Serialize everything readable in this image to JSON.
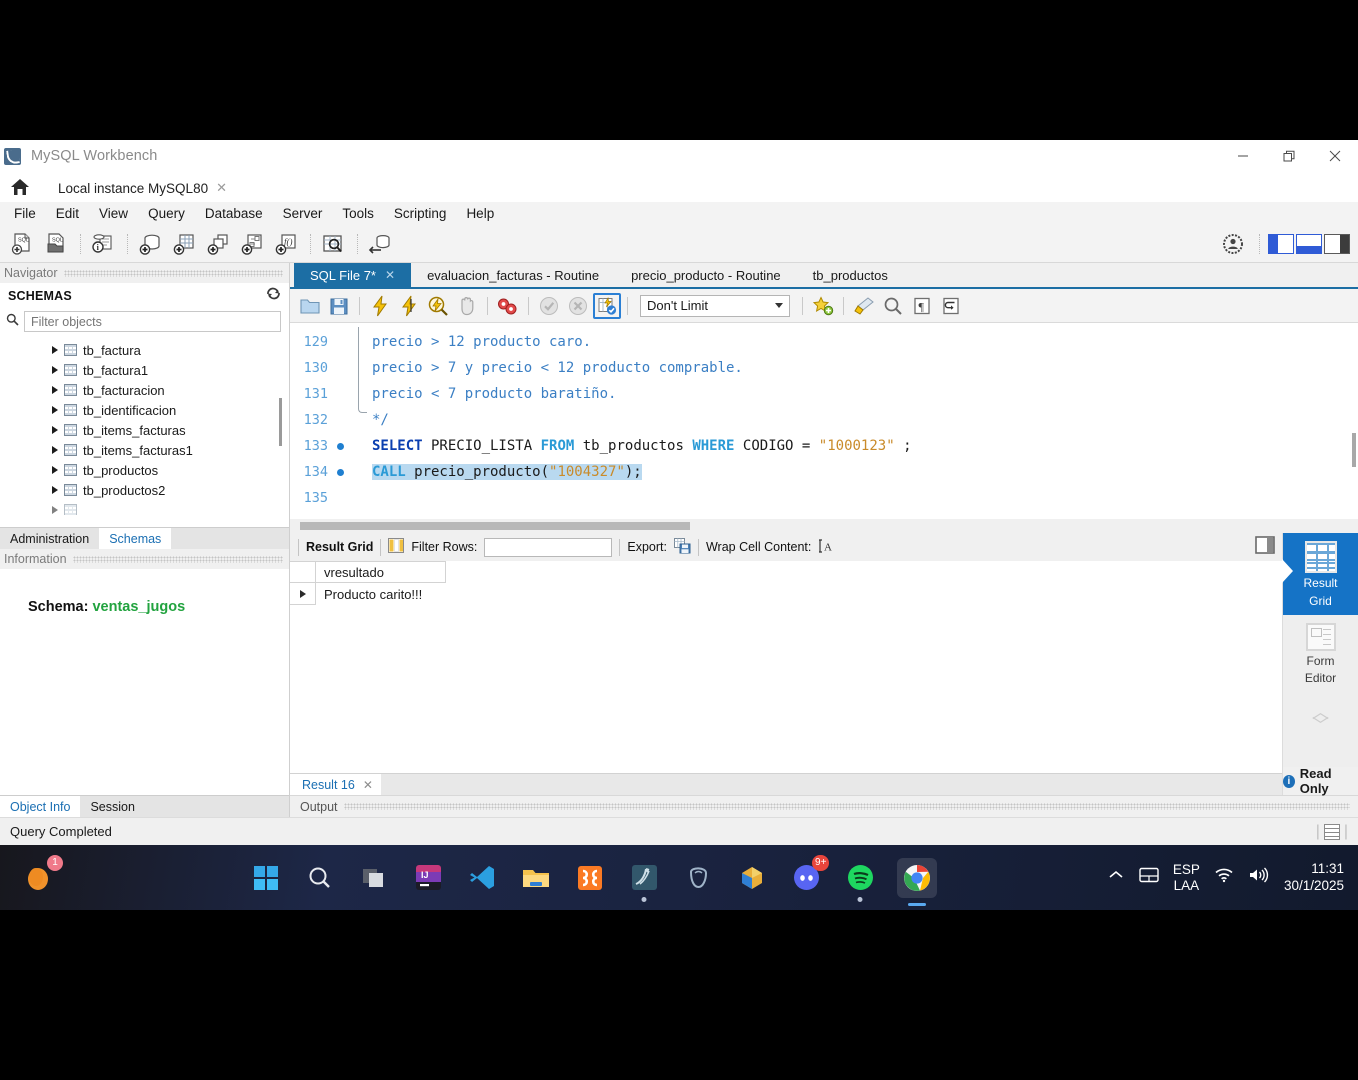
{
  "window": {
    "title": "MySQL Workbench",
    "minimize_label": "—",
    "maximize_label": "❐",
    "close_label": "✕"
  },
  "connection_tab": {
    "label": "Local instance MySQL80",
    "close_label": "✕"
  },
  "menubar": {
    "items": [
      {
        "label": "File"
      },
      {
        "label": "Edit"
      },
      {
        "label": "View"
      },
      {
        "label": "Query"
      },
      {
        "label": "Database"
      },
      {
        "label": "Server"
      },
      {
        "label": "Tools"
      },
      {
        "label": "Scripting"
      },
      {
        "label": "Help"
      }
    ]
  },
  "main_toolbar": {
    "buttons": [
      {
        "name": "new-sql-tab",
        "icon": "sql-new-file-icon"
      },
      {
        "name": "open-sql-script",
        "icon": "sql-open-file-icon"
      },
      {
        "name": "connection-info",
        "icon": "connection-info-icon"
      },
      {
        "name": "create-schema",
        "icon": "create-schema-icon"
      },
      {
        "name": "create-table",
        "icon": "create-table-icon"
      },
      {
        "name": "create-view",
        "icon": "create-view-icon"
      },
      {
        "name": "create-procedure",
        "icon": "create-procedure-icon"
      },
      {
        "name": "create-function",
        "icon": "create-function-icon"
      },
      {
        "name": "search-data",
        "icon": "search-table-data-icon"
      },
      {
        "name": "reconnect-server",
        "icon": "reconnect-icon"
      }
    ],
    "right_buttons": [
      {
        "name": "admin-user-icon",
        "icon": "user-badge-icon"
      },
      {
        "name": "toggle-sidebar",
        "icon": "panel-left-icon"
      },
      {
        "name": "toggle-output",
        "icon": "panel-bottom-icon"
      },
      {
        "name": "toggle-secondary-sidebar",
        "icon": "panel-right-icon"
      }
    ]
  },
  "navigator": {
    "title": "Navigator",
    "section_title": "SCHEMAS",
    "refresh_icon": "refresh-icon",
    "filter": {
      "placeholder": "Filter objects",
      "value": "",
      "icon": "search-icon"
    },
    "tree_items": [
      {
        "label": "tb_factura",
        "type": "table"
      },
      {
        "label": "tb_factura1",
        "type": "table"
      },
      {
        "label": "tb_facturacion",
        "type": "table"
      },
      {
        "label": "tb_identificacion",
        "type": "table"
      },
      {
        "label": "tb_items_facturas",
        "type": "table"
      },
      {
        "label": "tb_items_facturas1",
        "type": "table"
      },
      {
        "label": "tb_productos",
        "type": "table"
      },
      {
        "label": "tb_productos2",
        "type": "table"
      }
    ],
    "tabs": [
      {
        "label": "Administration",
        "active": false
      },
      {
        "label": "Schemas",
        "active": true
      }
    ]
  },
  "information": {
    "title": "Information",
    "schema_label": "Schema:",
    "schema_value": "ventas_jugos",
    "schema_value_color": "#22a33f",
    "tabs": [
      {
        "label": "Object Info",
        "active": true
      },
      {
        "label": "Session",
        "active": false
      }
    ]
  },
  "editor_tabs": [
    {
      "label": "SQL File 7*",
      "active": true,
      "closable": true,
      "close_label": "✕"
    },
    {
      "label": "evaluacion_facturas - Routine",
      "active": false,
      "closable": false
    },
    {
      "label": "precio_producto - Routine",
      "active": false,
      "closable": false
    },
    {
      "label": "tb_productos",
      "active": false,
      "closable": false
    }
  ],
  "sql_toolbar": {
    "buttons": [
      {
        "name": "open-script-button",
        "icon": "folder-icon"
      },
      {
        "name": "save-script-button",
        "icon": "floppy-disk-icon"
      },
      {
        "name": "execute-all-button",
        "icon": "lightning-bolt-icon"
      },
      {
        "name": "execute-current-button",
        "icon": "lightning-cursor-icon"
      },
      {
        "name": "explain-query-button",
        "icon": "magnifier-lightning-icon"
      },
      {
        "name": "stop-script-button",
        "icon": "stop-hand-icon"
      },
      {
        "name": "toggle-stop-on-error-button",
        "icon": "stop-on-error-icon"
      },
      {
        "name": "commit-button",
        "icon": "commit-check-icon"
      },
      {
        "name": "rollback-button",
        "icon": "rollback-x-icon"
      },
      {
        "name": "autocommit-button",
        "icon": "autocommit-icon"
      }
    ],
    "limit_select": {
      "value": "Don't Limit",
      "caret_icon": "chevron-down-icon"
    },
    "right_buttons": [
      {
        "name": "add-snippet-button",
        "icon": "star-plus-icon"
      },
      {
        "name": "beautify-query-button",
        "icon": "brush-icon"
      },
      {
        "name": "find-button",
        "icon": "magnifier-icon"
      },
      {
        "name": "toggle-invisible-chars-button",
        "icon": "pilcrow-icon"
      },
      {
        "name": "toggle-word-wrap-button",
        "icon": "wrap-arrow-icon"
      }
    ]
  },
  "code": {
    "lines": [
      {
        "number": "129",
        "breakpoint": false,
        "tokens": [
          {
            "t": "precio > 12 producto caro.",
            "c": "cmt"
          }
        ]
      },
      {
        "number": "130",
        "breakpoint": false,
        "tokens": [
          {
            "t": "precio > 7 y precio < 12 producto comprable.",
            "c": "cmt"
          }
        ]
      },
      {
        "number": "131",
        "breakpoint": false,
        "tokens": [
          {
            "t": "precio < 7 producto baratiño.",
            "c": "cmt"
          }
        ]
      },
      {
        "number": "132",
        "breakpoint": false,
        "tokens": [
          {
            "t": "*/",
            "c": "cmt"
          }
        ]
      },
      {
        "number": "133",
        "breakpoint": true,
        "tokens": [
          {
            "t": "SELECT",
            "c": "kw"
          },
          {
            "t": " PRECIO_LISTA ",
            "c": "pln"
          },
          {
            "t": "FROM",
            "c": "kw2"
          },
          {
            "t": " tb_productos ",
            "c": "pln"
          },
          {
            "t": "WHERE",
            "c": "kw2"
          },
          {
            "t": " CODIGO = ",
            "c": "pln"
          },
          {
            "t": "\"1000123\"",
            "c": "str"
          },
          {
            "t": " ;",
            "c": "pln"
          }
        ]
      },
      {
        "number": "134",
        "breakpoint": true,
        "selected": true,
        "tokens": [
          {
            "t": "CALL",
            "c": "kw2"
          },
          {
            "t": " precio_producto(",
            "c": "pln"
          },
          {
            "t": "\"1004327\"",
            "c": "str"
          },
          {
            "t": ");",
            "c": "pln"
          }
        ]
      },
      {
        "number": "135",
        "breakpoint": false,
        "tokens": [
          {
            "t": "",
            "c": "pln"
          }
        ]
      }
    ]
  },
  "result_toolbar": {
    "grid_label": "Result Grid",
    "grid_icon": "grid-icon",
    "filter_label": "Filter Rows:",
    "filter_value": "",
    "export_label": "Export:",
    "export_icon": "export-icon",
    "wrap_label": "Wrap Cell Content:",
    "wrap_icon": "wrap-text-icon",
    "maximize_icon": "maximize-panel-icon"
  },
  "result_grid": {
    "columns": [
      "vresultado"
    ],
    "rows": [
      [
        "Producto carito!!!"
      ]
    ]
  },
  "right_rail": {
    "items": [
      {
        "label": "Result\nGrid",
        "label_line1": "Result",
        "label_line2": "Grid",
        "active": true,
        "icon": "result-grid-icon"
      },
      {
        "label_line1": "Form",
        "label_line2": "Editor",
        "active": false,
        "icon": "form-editor-icon"
      }
    ],
    "scroll_arrows_icon": "chevron-updown-icon",
    "readonly_label": "Read Only",
    "readonly_info_icon": "info-icon"
  },
  "result_tabs": [
    {
      "label": "Result 16",
      "active": true,
      "close_label": "✕"
    }
  ],
  "output": {
    "title": "Output"
  },
  "statusbar": {
    "text": "Query Completed",
    "right_icon": "document-icon"
  },
  "taskbar": {
    "left_app": {
      "name": "firefox-icon",
      "badge": "1"
    },
    "apps": [
      {
        "name": "start-windows-icon"
      },
      {
        "name": "search-icon"
      },
      {
        "name": "task-view-icon"
      },
      {
        "name": "intellij-idea-icon"
      },
      {
        "name": "vscode-icon"
      },
      {
        "name": "file-explorer-icon"
      },
      {
        "name": "xampp-icon"
      },
      {
        "name": "mysql-workbench-icon",
        "running": true
      },
      {
        "name": "postgresql-icon"
      },
      {
        "name": "blender-icon"
      },
      {
        "name": "discord-icon",
        "badge": "9+"
      },
      {
        "name": "spotify-icon",
        "running": true
      },
      {
        "name": "chrome-icon",
        "active": true
      }
    ],
    "tray": {
      "overflow_icon": "chevron-up-icon",
      "touchpad_icon": "touchpad-icon",
      "language_line1": "ESP",
      "language_line2": "LAA",
      "wifi_icon": "wifi-icon",
      "volume_icon": "volume-icon",
      "time": "11:31",
      "date": "30/1/2025"
    }
  }
}
